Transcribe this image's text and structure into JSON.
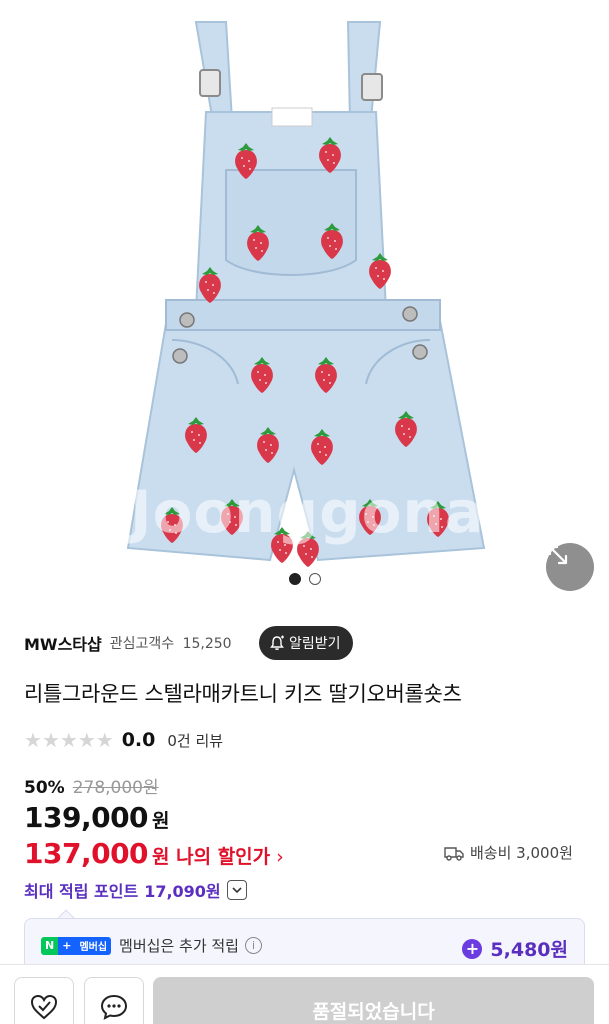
{
  "product_image": {
    "watermark": "Joonggonara",
    "slide_count": 2,
    "active_slide": 1,
    "expand_icon": "expand-arrows-icon"
  },
  "seller": {
    "name": "MW스타샵",
    "followers_label": "관심고객수",
    "followers_count": "15,250",
    "alarm_label": "알림받기",
    "alarm_icon": "bell-plus-icon"
  },
  "product": {
    "title": "리틀그라운드 스텔라매카트니 키즈 딸기오버롤숏츠",
    "rating": {
      "stars_filled": 0,
      "stars_total": 5,
      "score": "0.0",
      "review_text": "0건 리뷰"
    },
    "discount_rate": "50%",
    "original_price": "278,000원",
    "price": "139,000",
    "price_unit": "원",
    "my_price": "137,000",
    "my_price_label": "원 나의 할인가",
    "shipping_label": "배송비 3,000원",
    "points_label": "최대 적립 포인트",
    "points_value": "17,090원",
    "membership": {
      "badge_n": "N",
      "badge_plus": "+",
      "badge_label": "멤버십",
      "text": "멤버십은 추가 적립",
      "points": "5,480원"
    }
  },
  "bottom_bar": {
    "wishlist_icon": "heart-check-icon",
    "chat_icon": "chat-bubble-icon",
    "soldout_label": "품절되었습니다"
  },
  "colors": {
    "discount_red": "#e0112b",
    "points_purple": "#5a2fbf",
    "denim": "#c9ddef",
    "soldout_gray": "#cfcfcf"
  }
}
